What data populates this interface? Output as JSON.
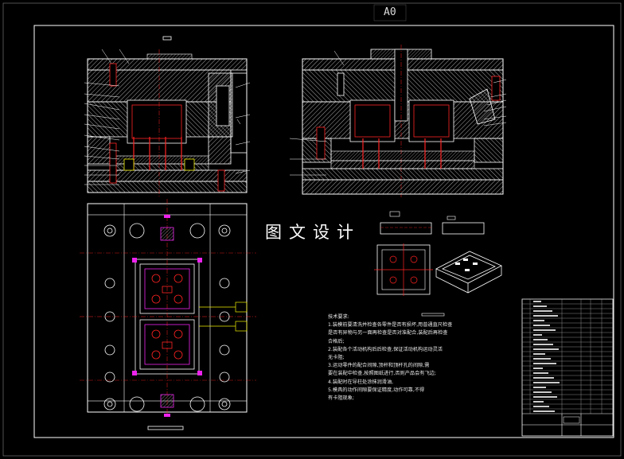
{
  "sheet": {
    "size_label": "A0",
    "watermark": "图文设计"
  },
  "technical_requirements": {
    "title": "技术要求:",
    "lines": [
      "1.装模前要清洗并检查各零件是否有损坏,用普通直尺检查",
      "是否有异物与另一面再检查是否对准配合,装配后再检查",
      "合格后;",
      "2.装配各个活动机构后后检查,保证活动机构运动灵活",
      "无卡阻;",
      "3.运动零件的配合间隙,顶杆和顶杆孔的间隙,需",
      "要在装配中检查,按照图纸进行,否则产品会有飞边;",
      "4.装配时在导柱处涂抹润滑油,",
      "5.模具的动作间隙要保证精度,动作可靠,不得",
      "有卡阻现象;"
    ]
  },
  "colors": {
    "background": "#000000",
    "line": "#ffffff",
    "hatch": "#cfcfcf",
    "red": "#ff2020",
    "magenta": "#e020e0",
    "yellow": "#e8e800",
    "cyan": "#20e0e0"
  }
}
